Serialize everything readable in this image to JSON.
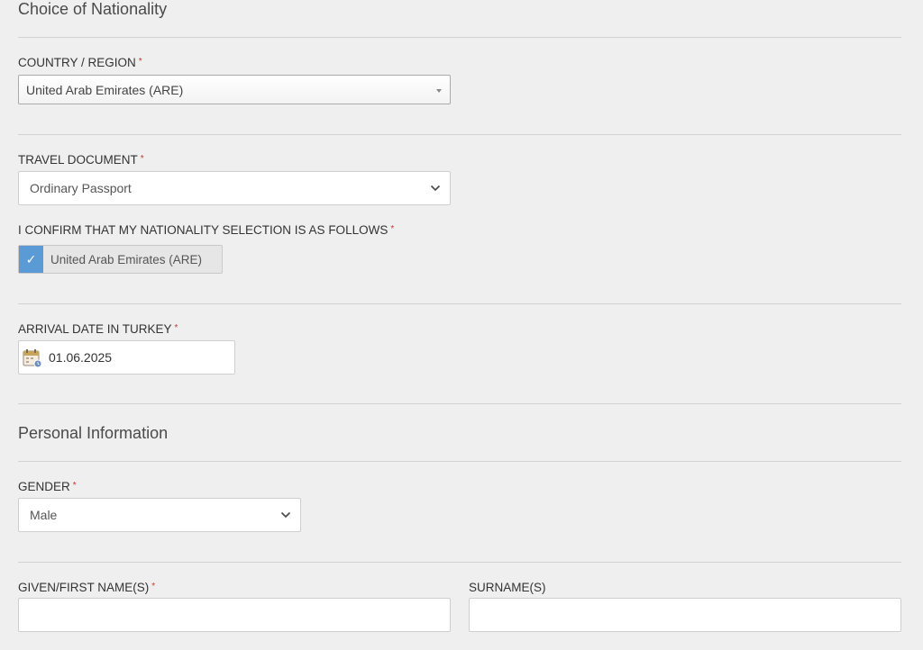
{
  "nationality_section": {
    "title": "Choice of Nationality",
    "country": {
      "label": "COUNTRY / REGION",
      "required": "*",
      "value": "United Arab Emirates (ARE)"
    },
    "travel_document": {
      "label": "TRAVEL DOCUMENT",
      "required": "*",
      "value": "Ordinary Passport"
    },
    "confirm": {
      "label": "I CONFIRM THAT MY NATIONALITY SELECTION IS AS FOLLOWS",
      "required": "*",
      "check_glyph": "✓",
      "value": "United Arab Emirates (ARE)",
      "checked": true
    },
    "arrival": {
      "label": "ARRIVAL DATE IN TURKEY",
      "required": "*",
      "value": "01.06.2025",
      "icon": "calendar-icon"
    }
  },
  "personal_section": {
    "title": "Personal Information",
    "gender": {
      "label": "GENDER",
      "required": "*",
      "value": "Male"
    },
    "given_name": {
      "label": "GIVEN/FIRST NAME(S)",
      "required": "*",
      "value": ""
    },
    "surname": {
      "label": "SURNAME(S)",
      "value": ""
    }
  },
  "colors": {
    "background": "#efefef",
    "accent_check": "#5b9bd5",
    "required_marker": "#c0392b"
  }
}
